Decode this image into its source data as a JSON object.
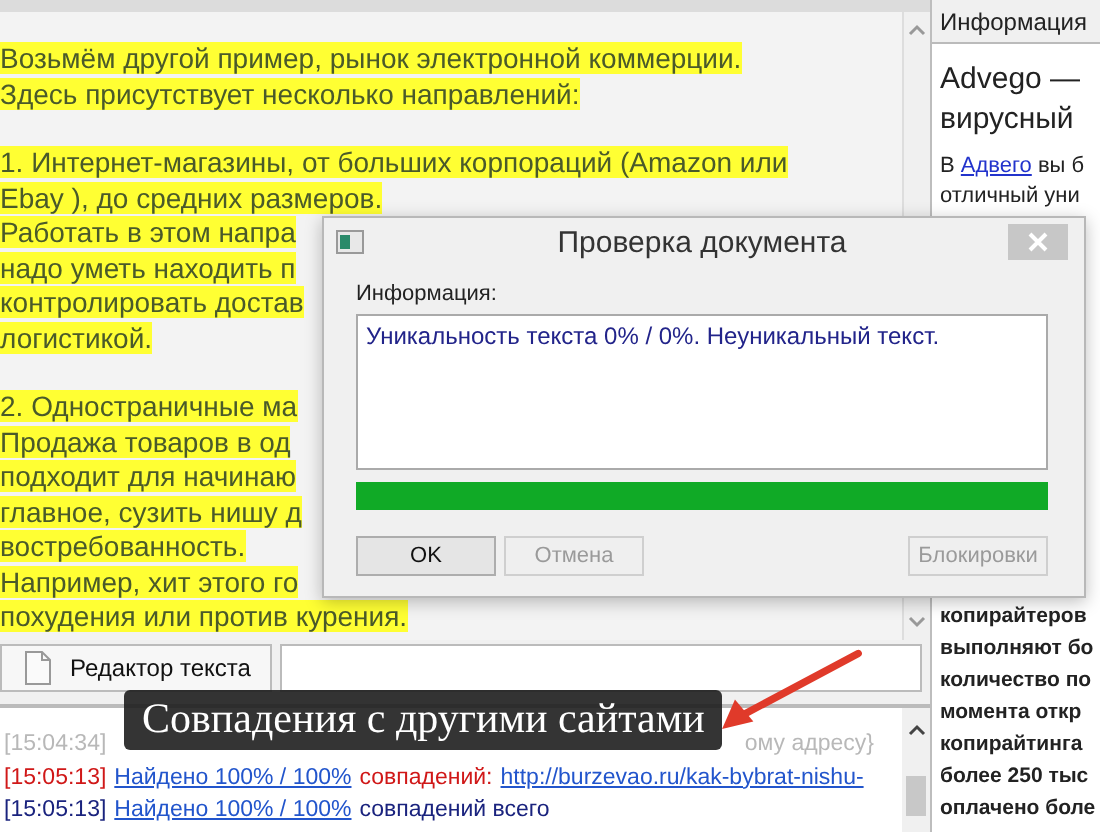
{
  "editor": {
    "paragraphs": [
      {
        "lines": [
          {
            "text": "Возьмём другой пример, рынок электронной коммерции.",
            "highlighted": true
          },
          {
            "text": "Здесь присутствует несколько направлений:",
            "highlighted": true
          }
        ]
      },
      {
        "lines": [
          {
            "text": "1. Интернет-магазины, от больших корпораций (Amazon или",
            "highlighted": true
          },
          {
            "text": "Ebay ), до средних размеров.",
            "highlighted": true
          },
          {
            "text": "Работать в этом напра",
            "highlighted": true
          },
          {
            "text": "надо уметь находить п",
            "highlighted": true
          },
          {
            "text": "контролировать достав",
            "highlighted": true
          },
          {
            "text": "логистикой.",
            "highlighted": true
          }
        ]
      },
      {
        "lines": [
          {
            "text": "2. Одностраничные ма",
            "highlighted": true
          },
          {
            "text": "Продажа товаров в од",
            "highlighted": true
          },
          {
            "text": "подходит для начинаю",
            "highlighted": true
          },
          {
            "text": "главное, сузить нишу д",
            "highlighted": true
          },
          {
            "text": "востребованность.",
            "highlighted": true
          },
          {
            "text": "Например, хит этого го",
            "highlighted": true
          },
          {
            "text": "похудения или против курения.",
            "highlighted": true
          }
        ]
      }
    ]
  },
  "tab": {
    "label": "Редактор текста",
    "selected": true
  },
  "log": [
    {
      "covered": true,
      "segments": [
        {
          "kind": "faded",
          "text": "[15:04:34]"
        },
        {
          "kind": "faded",
          "text": "ому адресу}"
        }
      ]
    },
    {
      "covered": false,
      "segments": [
        {
          "kind": "alert",
          "text": "[15:05:13]"
        },
        {
          "kind": "link",
          "text": "Найдено 100% / 100%"
        },
        {
          "kind": "alert",
          "text": "совпадений:"
        },
        {
          "kind": "link",
          "text": "http://burzevao.ru/kak-bybrat-nishu-"
        }
      ]
    },
    {
      "covered": false,
      "segments": [
        {
          "kind": "plain",
          "text": "[15:05:13]"
        },
        {
          "kind": "link",
          "text": "Найдено 100% / 100%"
        },
        {
          "kind": "plain",
          "text": "совпадений всего"
        }
      ]
    }
  ],
  "info_panel": {
    "tab": "Информация",
    "heading": [
      "Advego —",
      "вирусный"
    ],
    "intro": [
      {
        "kind": "mixed",
        "prefix": "В",
        "link": "Адвего",
        "suffix": "вы б"
      },
      {
        "kind": "plain",
        "text": "отличный уни"
      }
    ],
    "body": [
      "копирайтеров",
      "выполняют бо",
      "количество по",
      "момента откр",
      "копирайтинга",
      "более 250 тыс",
      "оплачено боле"
    ]
  },
  "dialog": {
    "title": "Проверка документа",
    "label": "Информация:",
    "message": "Уникальность текста 0% / 0%. Неуникальный текст.",
    "progress": {
      "level": 1
    },
    "buttons": [
      {
        "label": "OK",
        "disabled": false
      },
      {
        "label": "Отмена",
        "disabled": true
      },
      {
        "label": "Блокировки",
        "disabled": true
      }
    ]
  },
  "caption": "Совпадения с другими сайтами"
}
